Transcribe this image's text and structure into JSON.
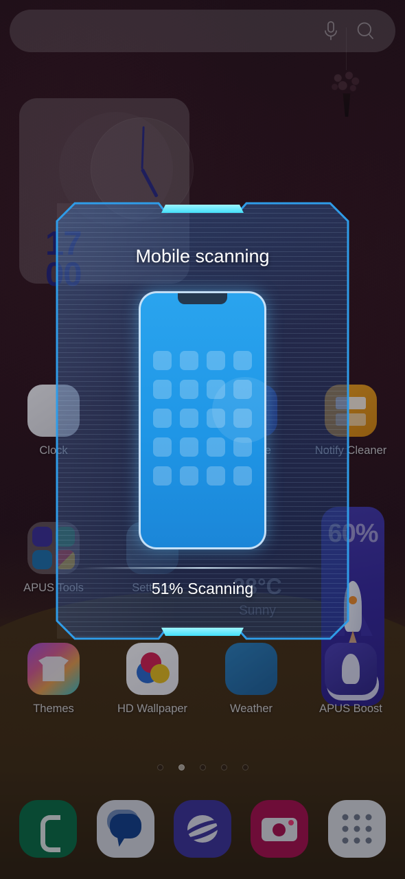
{
  "search": {
    "placeholder": "",
    "mic_icon": "microphone-icon",
    "search_icon": "search-icon"
  },
  "clock_widget": {
    "hours": "17",
    "minutes": "00",
    "digits_color": "#23237a"
  },
  "apps": {
    "row1": [
      {
        "label": "Clock",
        "icon": "clock-app-icon"
      },
      {
        "label": "Storage",
        "icon": "storage-icon"
      },
      {
        "label": "Notify Cleaner",
        "icon": "notify-cleaner-icon"
      }
    ],
    "row2": [
      {
        "label": "APUS Tools",
        "icon": "apus-tools-folder-icon"
      },
      {
        "label": "Settings",
        "icon": "settings-icon"
      }
    ],
    "row3": [
      {
        "label": "Themes",
        "icon": "themes-icon"
      },
      {
        "label": "HD Wallpaper",
        "icon": "hd-wallpaper-icon"
      },
      {
        "label": "Weather",
        "icon": "weather-icon"
      },
      {
        "label": "APUS Boost",
        "icon": "apus-boost-icon"
      }
    ]
  },
  "boost_widget": {
    "percent": "60%",
    "icon": "rocket-icon"
  },
  "weather_widget": {
    "temperature": "28°C",
    "condition": "Sunny"
  },
  "page_indicator": {
    "total": 5,
    "active_index": 1
  },
  "dock": [
    {
      "label": "Phone",
      "icon": "phone-icon"
    },
    {
      "label": "Messages",
      "icon": "message-icon"
    },
    {
      "label": "Internet",
      "icon": "globe-icon"
    },
    {
      "label": "Camera",
      "icon": "camera-icon"
    },
    {
      "label": "Apps",
      "icon": "app-drawer-icon"
    }
  ],
  "scan_dialog": {
    "title": "Mobile scanning",
    "status": "51% Scanning",
    "progress_percent": 51,
    "accent_color": "#35dcf8",
    "frame_color": "#2f9ce8",
    "phone_illustration": "phone-scan-illustration"
  }
}
